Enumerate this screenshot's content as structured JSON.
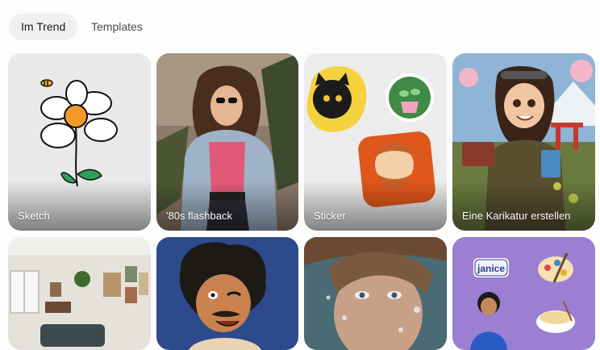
{
  "tabs": [
    {
      "label": "Im Trend",
      "active": true
    },
    {
      "label": "Templates",
      "active": false
    }
  ],
  "cards_row1": [
    {
      "label": "Sketch",
      "image": "flower-sketch-image"
    },
    {
      "label": "'80s flashback",
      "image": "eighties-woman-photo"
    },
    {
      "label": "Sticker",
      "image": "sticker-collection-image"
    },
    {
      "label": "Eine Karikatur erstellen",
      "image": "caricature-illustration"
    }
  ],
  "cards_row2": [
    {
      "image": "living-room-photo"
    },
    {
      "image": "cartoon-man-illustration"
    },
    {
      "image": "portrait-water-photo"
    },
    {
      "image": "janice-sticker-sheet",
      "sticker_text": "janice"
    }
  ],
  "colors": {
    "tab_active_bg": "#f0f0f0",
    "label_text": "#ffffff"
  }
}
